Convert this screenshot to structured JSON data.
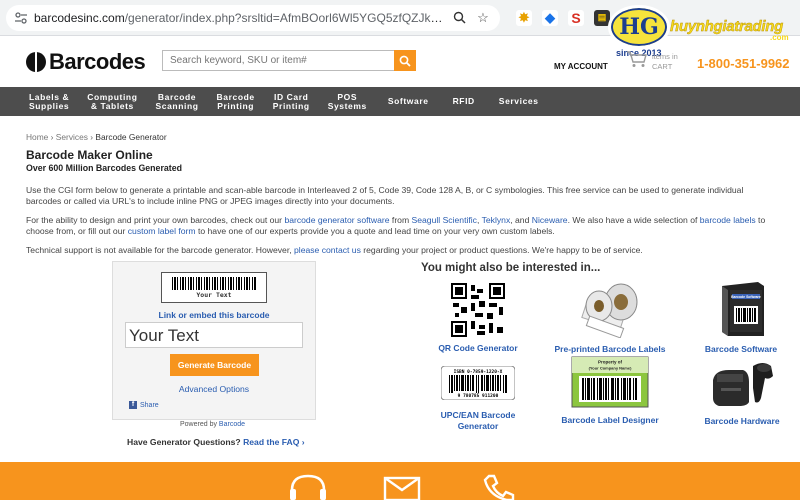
{
  "browser": {
    "url_domain": "barcodesinc.com",
    "url_path": "/generator/index.php?srsltid=AfmBOorl6Wl5YGQ5zfQZJkgJ1p90...",
    "ext_icons": [
      "extension-icon",
      "bookmark-tag-icon",
      "s-extension-icon",
      "reader-icon"
    ],
    "overlay_brand": "huynhgiatrading",
    "overlay_since": "since 2013",
    "overlay_dotcom": ".com"
  },
  "header": {
    "logo_text": "Barcodes",
    "search_placeholder": "Search keyword, SKU or item#",
    "my_account": "MY ACCOUNT",
    "cart_items": "items in",
    "cart_label": "CART",
    "phone": "1-800-351-9962"
  },
  "nav": [
    "Labels &\nSupplies",
    "Computing\n& Tablets",
    "Barcode\nScanning",
    "Barcode\nPrinting",
    "ID Card\nPrinting",
    "POS\nSystems",
    "Software",
    "RFID",
    "Services"
  ],
  "breadcrumb": {
    "home": "Home",
    "services": "Services",
    "current": "Barcode Generator"
  },
  "page": {
    "title": "Barcode Maker Online",
    "subtitle": "Over 600 Million Barcodes Generated",
    "p1": "Use the CGI form below to generate a printable and scan-able barcode in Interleaved 2 of 5, Code 39, Code 128 A, B, or C symbologies. This free service can be used to generate individual barcodes or called via URL's to include inline PNG or JPEG images directly into your documents.",
    "p2_a": "For the ability to design and print your own barcodes, check out our ",
    "p2_link1": "barcode generator software",
    "p2_b": " from ",
    "p2_link2": "Seagull Scientific",
    "p2_c": ", ",
    "p2_link3": "Teklynx",
    "p2_d": ", and ",
    "p2_link4": "Niceware",
    "p2_e": ". We also have a wide selection of ",
    "p2_link5": "barcode labels",
    "p2_f": " to choose from, or fill out our ",
    "p2_link6": "custom label form",
    "p2_g": " to have one of our experts provide you a quote and lead time on your very own custom labels.",
    "p3_a": "Technical support is not available for the barcode generator. However, ",
    "p3_link": "please contact us",
    "p3_b": " regarding your project or product questions. We're happy to be of service."
  },
  "generator": {
    "sample_caption": "Your Text",
    "embed_label": "Link or embed this barcode",
    "text_value": "Your Text",
    "generate_label": "Generate Barcode",
    "advanced_label": "Advanced Options",
    "share_label": "Share",
    "powered_prefix": "Powered by ",
    "powered_link": "Barcode",
    "faq_prefix": "Have Generator Questions? ",
    "faq_link": "Read the FAQ ›"
  },
  "interest": {
    "title": "You might also be interested in...",
    "tiles": [
      "QR Code Generator",
      "Pre-printed Barcode Labels",
      "Barcode Software",
      "UPC/EAN Barcode Generator",
      "Barcode Label Designer",
      "Barcode Hardware"
    ],
    "upc_digits_top": "ISBN 0-7859-1220-X",
    "upc_digits_bottom": "9 780785 911200",
    "label_designer_top": "Property of",
    "label_designer_sub": "(Your Company Name)",
    "software_box_text": "Barcode Software"
  },
  "colors": {
    "accent": "#f7941d",
    "nav": "#4d4d4d",
    "link": "#2a5db0"
  }
}
